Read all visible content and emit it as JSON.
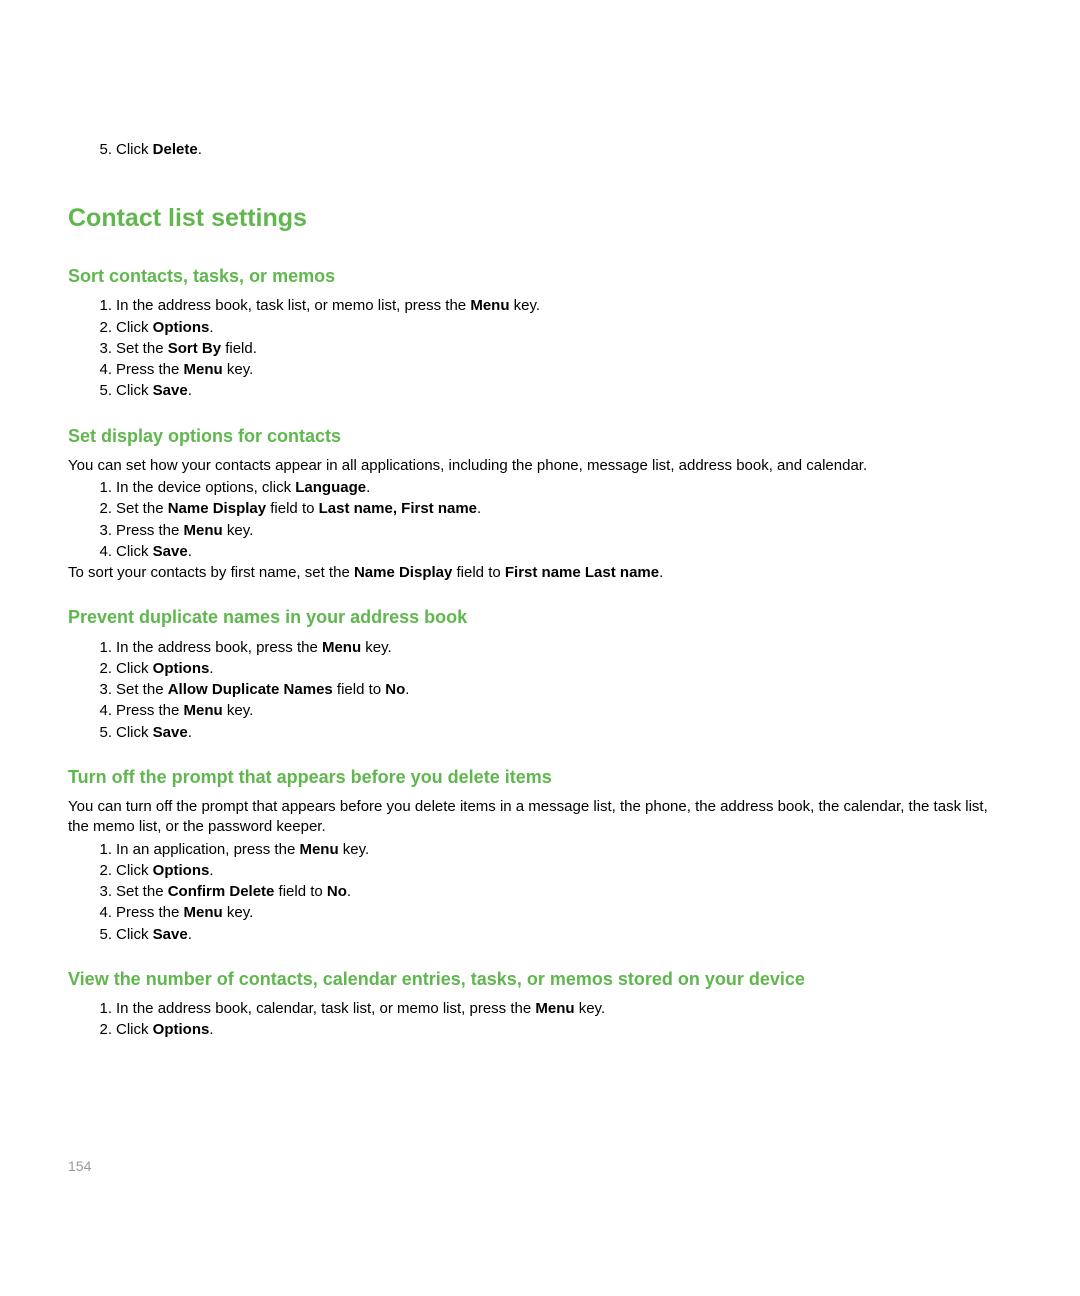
{
  "topList": {
    "item5_pre": "Click ",
    "item5_bold": "Delete",
    "item5_post": "."
  },
  "mainHeading": "Contact list settings",
  "section1": {
    "heading": "Sort contacts, tasks, or memos",
    "item1_pre": "In the address book, task list, or memo list, press the ",
    "item1_bold": "Menu",
    "item1_post": " key.",
    "item2_pre": "Click ",
    "item2_bold": "Options",
    "item2_post": ".",
    "item3_pre": "Set the ",
    "item3_bold": "Sort By",
    "item3_post": " field.",
    "item4_pre": "Press the ",
    "item4_bold": "Menu",
    "item4_post": " key.",
    "item5_pre": "Click ",
    "item5_bold": "Save",
    "item5_post": "."
  },
  "section2": {
    "heading": "Set display options for contacts",
    "intro": "You can set how your contacts appear in all applications, including the phone, message list, address book, and calendar.",
    "item1_pre": "In the device options, click ",
    "item1_bold": "Language",
    "item1_post": ".",
    "item2_pre": "Set the ",
    "item2_bold1": "Name Display",
    "item2_mid": " field to ",
    "item2_bold2": "Last name, First name",
    "item2_post": ".",
    "item3_pre": "Press the ",
    "item3_bold": "Menu",
    "item3_post": " key.",
    "item4_pre": "Click ",
    "item4_bold": "Save",
    "item4_post": ".",
    "outro_pre": "To sort your contacts by first name, set the ",
    "outro_bold1": "Name Display",
    "outro_mid": " field to ",
    "outro_bold2": "First name Last name",
    "outro_post": "."
  },
  "section3": {
    "heading": "Prevent duplicate names in your address book",
    "item1_pre": "In the address book, press the ",
    "item1_bold": "Menu",
    "item1_post": " key.",
    "item2_pre": "Click ",
    "item2_bold": "Options",
    "item2_post": ".",
    "item3_pre": "Set the ",
    "item3_bold1": "Allow Duplicate Names",
    "item3_mid": " field to ",
    "item3_bold2": "No",
    "item3_post": ".",
    "item4_pre": "Press the ",
    "item4_bold": "Menu",
    "item4_post": " key.",
    "item5_pre": "Click ",
    "item5_bold": "Save",
    "item5_post": "."
  },
  "section4": {
    "heading": "Turn off the prompt that appears before you delete items",
    "intro": "You can turn off the prompt that appears before you delete items in a message list, the phone, the address book, the calendar, the task list, the memo list, or the password keeper.",
    "item1_pre": "In an application, press the ",
    "item1_bold": "Menu",
    "item1_post": " key.",
    "item2_pre": "Click ",
    "item2_bold": "Options",
    "item2_post": ".",
    "item3_pre": "Set the ",
    "item3_bold1": "Confirm Delete",
    "item3_mid": " field to ",
    "item3_bold2": "No",
    "item3_post": ".",
    "item4_pre": "Press the ",
    "item4_bold": "Menu",
    "item4_post": " key.",
    "item5_pre": "Click ",
    "item5_bold": "Save",
    "item5_post": "."
  },
  "section5": {
    "heading": "View the number of contacts, calendar entries, tasks, or memos stored on your device",
    "item1_pre": "In the address book, calendar, task list, or memo list, press the ",
    "item1_bold": "Menu",
    "item1_post": " key.",
    "item2_pre": "Click ",
    "item2_bold": "Options",
    "item2_post": "."
  },
  "pageNumber": "154"
}
